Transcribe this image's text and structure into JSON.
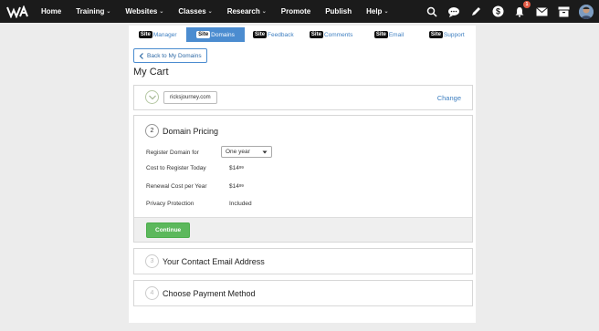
{
  "nav": {
    "items": [
      {
        "label": "Home",
        "caret": false
      },
      {
        "label": "Training",
        "caret": true
      },
      {
        "label": "Websites",
        "caret": true
      },
      {
        "label": "Classes",
        "caret": true
      },
      {
        "label": "Research",
        "caret": true
      },
      {
        "label": "Promote",
        "caret": false
      },
      {
        "label": "Publish",
        "caret": false
      },
      {
        "label": "Help",
        "caret": true
      }
    ],
    "caret_glyph": "⌄",
    "notification_count": "1"
  },
  "tabs": [
    {
      "badge": "Site",
      "label": "Manager"
    },
    {
      "badge": "Site",
      "label": "Domains"
    },
    {
      "badge": "Site",
      "label": "Feedback"
    },
    {
      "badge": "Site",
      "label": "Comments"
    },
    {
      "badge": "Site",
      "label": "Email"
    },
    {
      "badge": "Site",
      "label": "Support"
    }
  ],
  "back_button": "Back to My Domains",
  "page_title": "My Cart",
  "domain_card": {
    "domain": "ricksjourney.com",
    "change_label": "Change"
  },
  "pricing": {
    "step": "2",
    "title": "Domain Pricing",
    "register_label": "Register Domain for",
    "register_value": "One year",
    "cost_label": "Cost to Register Today",
    "cost_dollars": "$14",
    "cost_cents": "99",
    "renewal_label": "Renewal Cost per Year",
    "renewal_dollars": "$14",
    "renewal_cents": "99",
    "privacy_label": "Privacy Protection",
    "privacy_value": "Included",
    "continue_label": "Continue"
  },
  "contact": {
    "step": "3",
    "title": "Your Contact Email Address"
  },
  "payment": {
    "step": "4",
    "title": "Choose Payment Method"
  },
  "colors": {
    "active_tab": "#4b8cd0",
    "continue": "#5cb85c",
    "link": "#3e7fc1"
  }
}
